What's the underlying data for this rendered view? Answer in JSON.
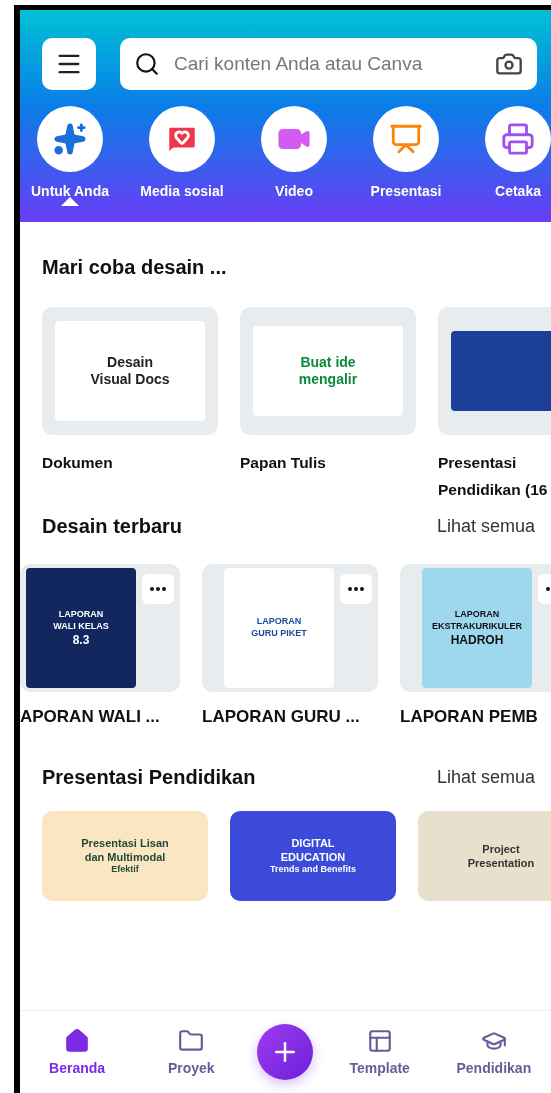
{
  "search": {
    "placeholder": "Cari konten Anda atau Canva"
  },
  "categories": [
    {
      "label": "Untuk Anda",
      "kind": "sparkle",
      "selected": true
    },
    {
      "label": "Media sosial",
      "kind": "social",
      "selected": false
    },
    {
      "label": "Video",
      "kind": "video",
      "selected": false
    },
    {
      "label": "Presentasi",
      "kind": "presentation",
      "selected": false
    },
    {
      "label": "Cetaka",
      "kind": "print",
      "selected": false
    }
  ],
  "try_design": {
    "title": "Mari coba desain ...",
    "items": [
      {
        "label": "Dokumen",
        "thumb": [
          "Desain",
          "Visual Docs"
        ]
      },
      {
        "label": "Papan Tulis",
        "thumb": [
          "Buat ide",
          "mengalir"
        ]
      },
      {
        "label": "Presentasi Pendidikan (16"
      }
    ]
  },
  "recent": {
    "title": "Desain terbaru",
    "link": "Lihat semua",
    "items": [
      {
        "label": "APORAN WALI ...",
        "thumb": [
          "LAPORAN",
          "WALI KELAS",
          "8.3"
        ]
      },
      {
        "label": "LAPORAN GURU ...",
        "thumb": [
          "LAPORAN",
          "GURU PIKET"
        ]
      },
      {
        "label": "LAPORAN PEMB",
        "thumb": [
          "LAPORAN",
          "EKSTRAKURIKULER",
          "HADROH"
        ]
      }
    ]
  },
  "education": {
    "title": "Presentasi Pendidikan",
    "link": "Lihat semua",
    "items": [
      {
        "thumb": [
          "Presentasi Lisan",
          "dan Multimodal",
          "Efektif"
        ]
      },
      {
        "thumb": [
          "DIGITAL",
          "EDUCATION",
          "Trends and Benefits"
        ]
      },
      {
        "thumb": [
          "Project",
          "Presentation"
        ]
      }
    ]
  },
  "bottom_nav": [
    {
      "label": "Beranda",
      "kind": "home",
      "selected": true
    },
    {
      "label": "Proyek",
      "kind": "folder",
      "selected": false
    },
    {
      "kind": "create",
      "selected": false
    },
    {
      "label": "Template",
      "kind": "template",
      "selected": false
    },
    {
      "label": "Pendidikan",
      "kind": "education",
      "selected": false
    }
  ]
}
